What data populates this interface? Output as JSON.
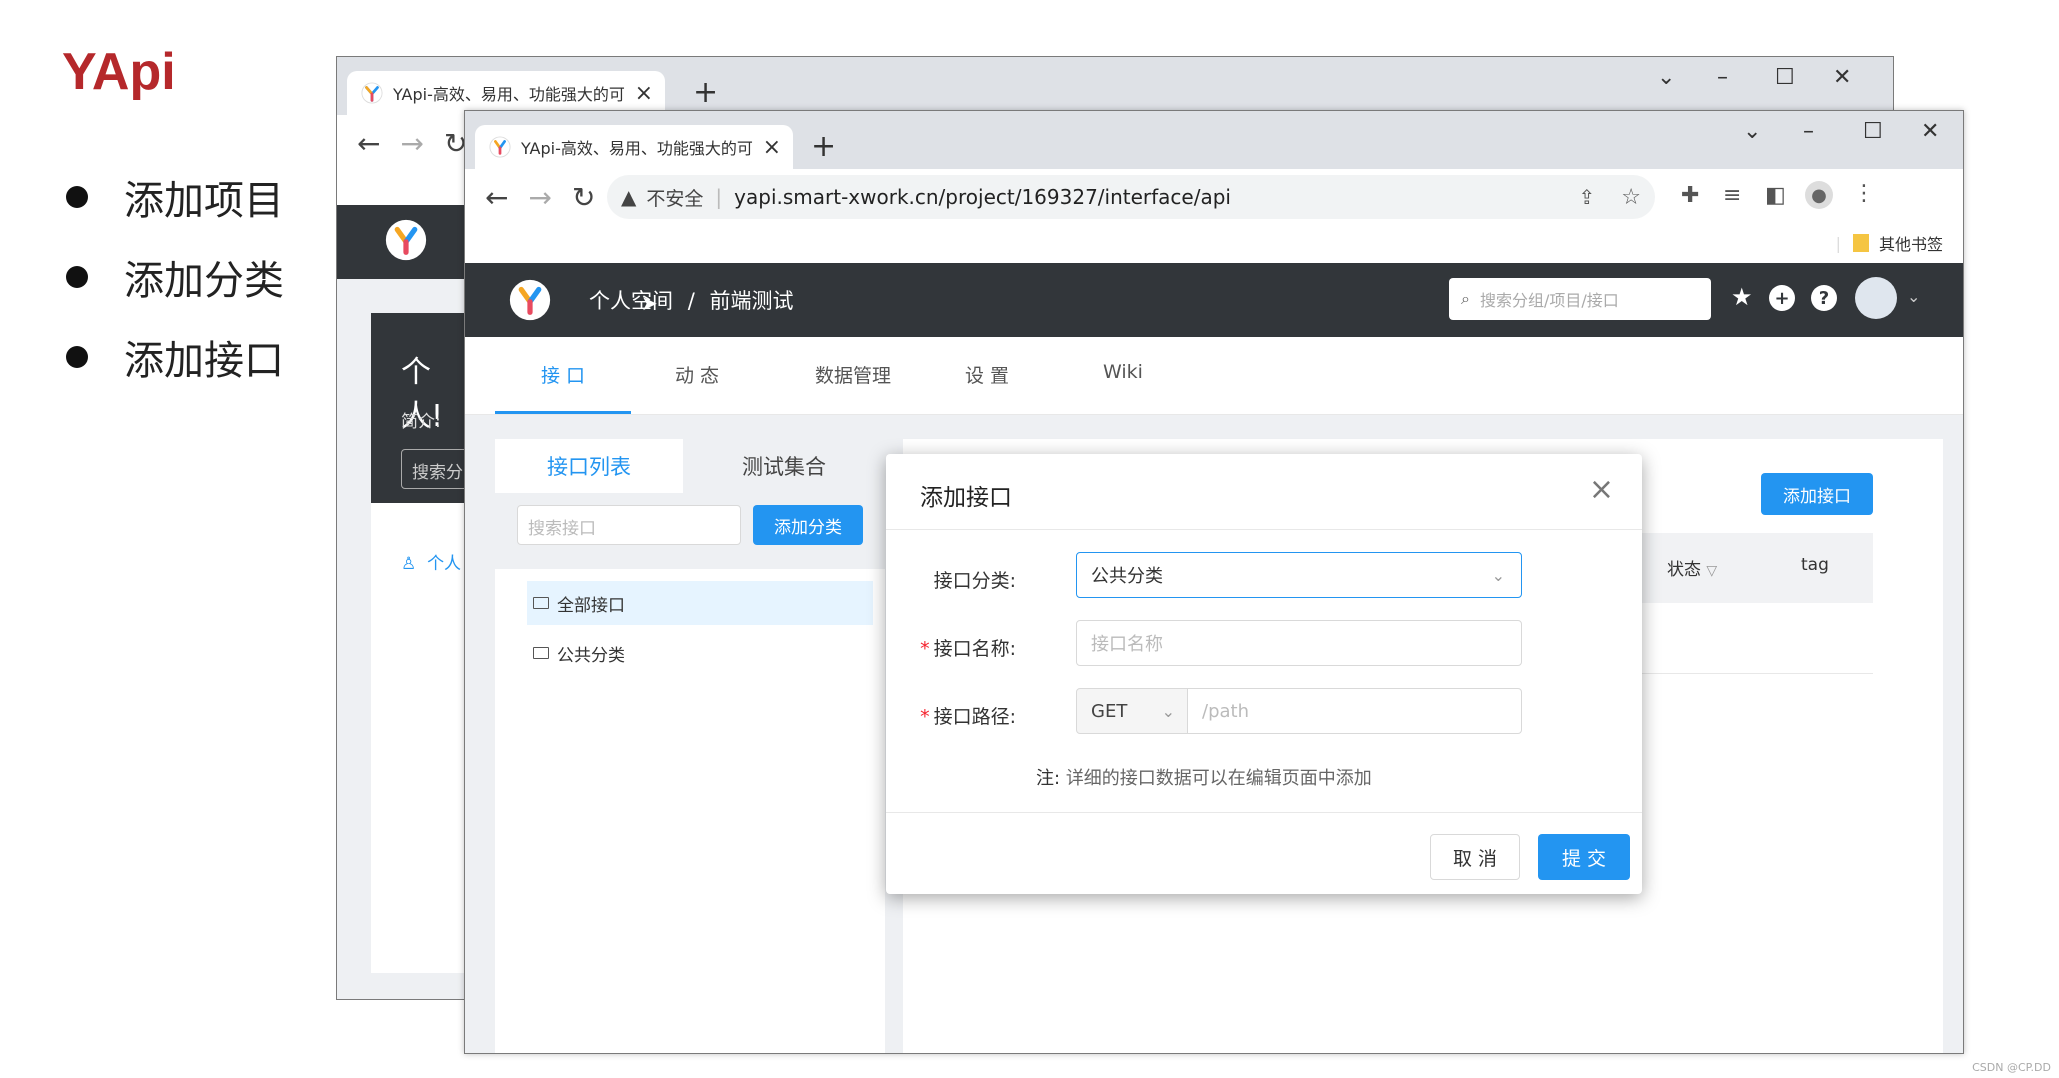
{
  "slide": {
    "title": "YApi",
    "bullets": [
      "添加项目",
      "添加分类",
      "添加接口"
    ],
    "credit": "CSDN @CP.DD"
  },
  "back_window": {
    "tab_title": "YApi-高效、易用、功能强大的可",
    "project_title": "个人!",
    "intro_label": "简介:",
    "search_placeholder": "搜索分",
    "member_label": "个人"
  },
  "browser": {
    "tab_title": "YApi-高效、易用、功能强大的可",
    "security_label": "不安全",
    "url": "yapi.smart-xwork.cn/project/169327/interface/api",
    "bookmark_folder": "其他书签"
  },
  "app_header": {
    "breadcrumb_space": "个人空间",
    "breadcrumb_sep": "/",
    "breadcrumb_project": "前端测试",
    "search_placeholder": "搜索分组/项目/接口"
  },
  "subnav": {
    "tabs": [
      "接 口",
      "动 态",
      "数据管理",
      "设 置",
      "Wiki"
    ],
    "active_index": 0
  },
  "left_panel": {
    "tabs": [
      "接口列表",
      "测试集合"
    ],
    "search_placeholder": "搜索接口",
    "add_category_button": "添加分类",
    "tree": [
      "全部接口",
      "公共分类"
    ]
  },
  "right_panel": {
    "add_interface_button": "添加接口",
    "columns": [
      "状态",
      "tag"
    ]
  },
  "modal": {
    "title": "添加接口",
    "fields": {
      "category_label": "接口分类:",
      "category_value": "公共分类",
      "name_label": "接口名称:",
      "name_placeholder": "接口名称",
      "path_label": "接口路径:",
      "method_value": "GET",
      "path_placeholder": "/path"
    },
    "note_prefix": "注:",
    "note": "详细的接口数据可以在编辑页面中添加",
    "cancel_label": "取 消",
    "submit_label": "提 交"
  },
  "colors": {
    "accent": "#2395f1",
    "header_dark": "#32363a",
    "slide_title": "#b5282b",
    "required": "#f5222d"
  }
}
